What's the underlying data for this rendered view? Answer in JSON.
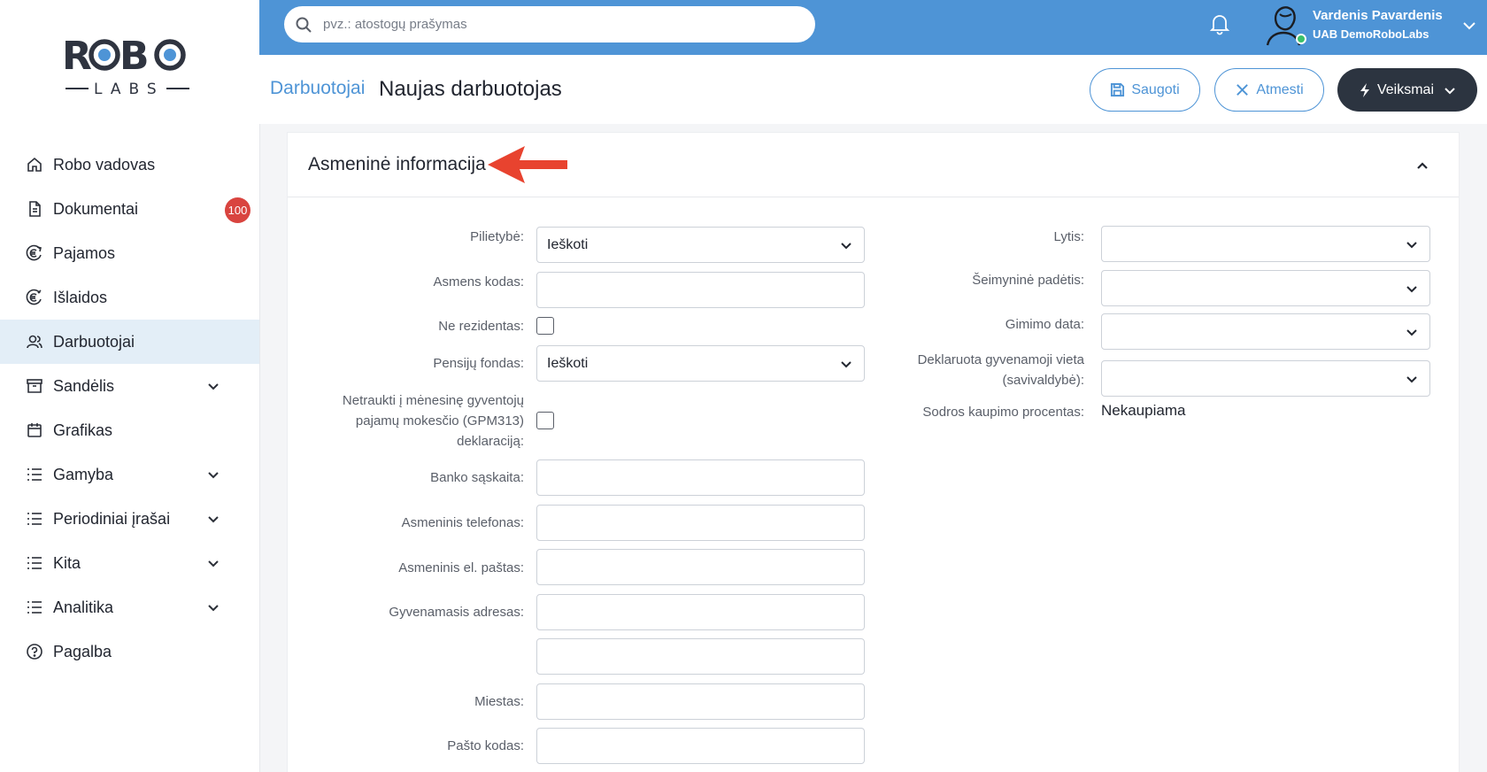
{
  "sidebar": {
    "logo": {
      "line1": "ROBO",
      "line2": "LABS"
    },
    "items": [
      {
        "label": "Robo vadovas",
        "icon": "home-icon"
      },
      {
        "label": "Dokumentai",
        "icon": "document-icon",
        "badge": "100"
      },
      {
        "label": "Pajamos",
        "icon": "euro-in-icon"
      },
      {
        "label": "Išlaidos",
        "icon": "euro-out-icon"
      },
      {
        "label": "Darbuotojai",
        "icon": "users-icon",
        "active": true
      },
      {
        "label": "Sandėlis",
        "icon": "archive-icon",
        "expandable": true
      },
      {
        "label": "Grafikas",
        "icon": "calendar-icon"
      },
      {
        "label": "Gamyba",
        "icon": "list-icon",
        "expandable": true
      },
      {
        "label": "Periodiniai įrašai",
        "icon": "list-icon",
        "expandable": true
      },
      {
        "label": "Kita",
        "icon": "list-icon",
        "expandable": true
      },
      {
        "label": "Analitika",
        "icon": "list-icon",
        "expandable": true
      },
      {
        "label": "Pagalba",
        "icon": "help-icon"
      }
    ]
  },
  "header": {
    "search_placeholder": "pvz.: atostogų prašymas",
    "user_name": "Vardenis Pavardenis",
    "user_company": "UAB DemoRoboLabs",
    "accent": "#4e94d6"
  },
  "page": {
    "breadcrumb": "Darbuotojai",
    "title": "Naujas darbuotojas",
    "save_label": "Saugoti",
    "cancel_label": "Atmesti",
    "actions_label": "Veiksmai"
  },
  "section": {
    "title": "Asmeninė informacija",
    "left": {
      "citizenship_label": "Pilietybė:",
      "citizenship_value": "Ieškoti",
      "personal_code_label": "Asmens kodas:",
      "non_resident_label": "Ne rezidentas:",
      "pension_fund_label": "Pensijų fondas:",
      "pension_fund_value": "Ieškoti",
      "gpm_line1": "Netraukti į mėnesinę gyventojų",
      "gpm_line2": "pajamų mokesčio (GPM313)",
      "gpm_line3": "deklaraciją:",
      "bank_account_label": "Banko sąskaita:",
      "phone_label": "Asmeninis telefonas:",
      "email_label": "Asmeninis el. paštas:",
      "address_label": "Gyvenamasis adresas:",
      "city_label": "Miestas:",
      "postal_label": "Pašto kodas:"
    },
    "right": {
      "gender_label": "Lytis:",
      "marital_label": "Šeimyninė padėtis:",
      "birth_label": "Gimimo data:",
      "residence_line1": "Deklaruota gyvenamoji vieta",
      "residence_line2": "(savivaldybė):",
      "sodra_label": "Sodros kaupimo procentas:",
      "sodra_value": "Nekaupiama"
    }
  }
}
